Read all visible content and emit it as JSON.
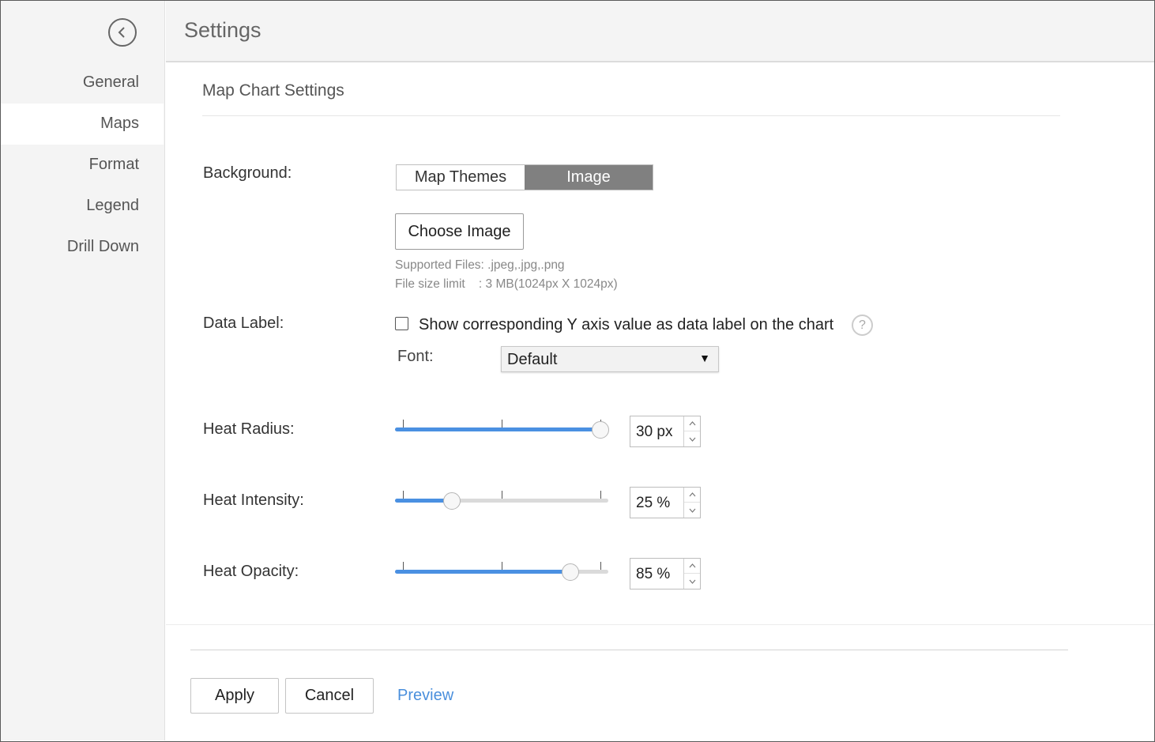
{
  "header": {
    "title": "Settings"
  },
  "sidebar": {
    "items": [
      {
        "label": "General"
      },
      {
        "label": "Maps"
      },
      {
        "label": "Format"
      },
      {
        "label": "Legend"
      },
      {
        "label": "Drill Down"
      }
    ],
    "active": "Maps"
  },
  "main": {
    "section_title": "Map Chart Settings",
    "background": {
      "label": "Background:",
      "options": [
        "Map Themes",
        "Image"
      ],
      "selected": "Image",
      "choose_button": "Choose Image",
      "supported_files": "Supported Files: .jpeg,.jpg,.png",
      "size_limit": "File size limit    : 3 MB(1024px X 1024px)"
    },
    "data_label": {
      "label": "Data Label:",
      "checkbox_text": "Show corresponding Y axis value as data label on the chart",
      "checked": false,
      "help_icon": "?",
      "font_label": "Font:",
      "font_value": "Default",
      "dropdown_arrow": "▼"
    },
    "heat_radius": {
      "label": "Heat Radius:",
      "value": "30 px",
      "fraction": 0.963
    },
    "heat_intensity": {
      "label": "Heat Intensity:",
      "value": "25 %",
      "fraction": 0.267
    },
    "heat_opacity": {
      "label": "Heat Opacity:",
      "value": "85 %",
      "fraction": 0.822
    }
  },
  "footer": {
    "apply": "Apply",
    "cancel": "Cancel",
    "preview": "Preview"
  },
  "colors": {
    "accent": "#4a90e2",
    "link": "#4a8fdc",
    "segment_active": "#808080"
  }
}
